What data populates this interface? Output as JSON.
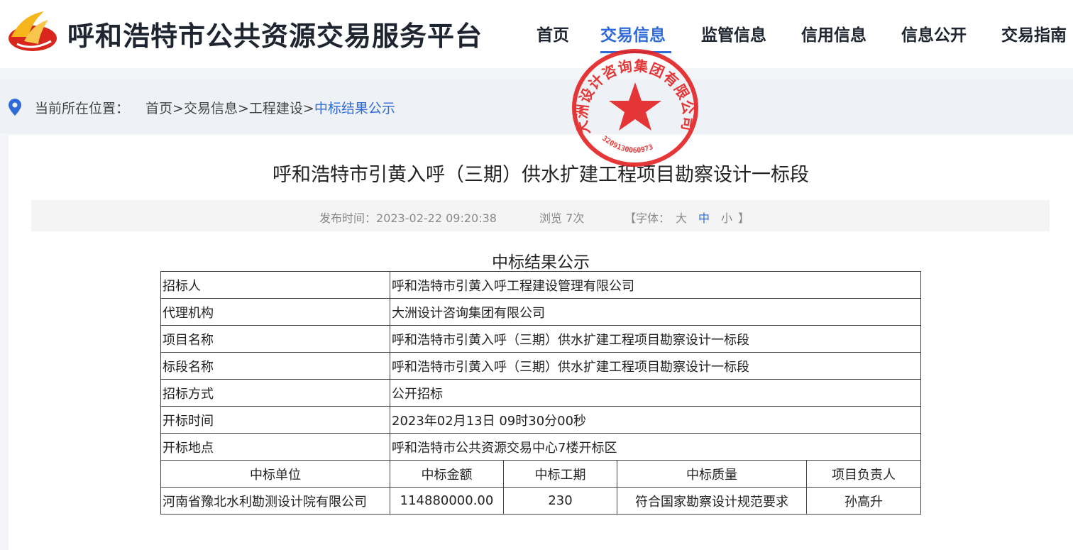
{
  "header": {
    "site_title": "呼和浩特市公共资源交易服务平台",
    "nav": [
      {
        "label": "首页",
        "active": false
      },
      {
        "label": "交易信息",
        "active": true
      },
      {
        "label": "监管信息",
        "active": false
      },
      {
        "label": "信用信息",
        "active": false
      },
      {
        "label": "信息公开",
        "active": false
      },
      {
        "label": "交易指南",
        "active": false
      }
    ]
  },
  "breadcrumb": {
    "prefix": "当前所在位置：",
    "items": [
      "首页",
      "交易信息",
      "工程建设"
    ],
    "separator": ">",
    "current": "中标结果公示"
  },
  "article": {
    "title": "呼和浩特市引黄入呼（三期）供水扩建工程项目勘察设计一标段",
    "publish_label": "发布时间：",
    "publish_time": "2023-02-22 09:20:38",
    "views": "浏览 7次",
    "font_label": "【字体：",
    "font_options": [
      "大",
      "中",
      "小"
    ],
    "font_close": "】",
    "active_font": "中"
  },
  "result": {
    "caption": "中标结果公示",
    "rows": [
      {
        "label": "招标人",
        "value": "呼和浩特市引黄入呼工程建设管理有限公司"
      },
      {
        "label": "代理机构",
        "value": "大洲设计咨询集团有限公司"
      },
      {
        "label": "项目名称",
        "value": "呼和浩特市引黄入呼（三期）供水扩建工程项目勘察设计一标段"
      },
      {
        "label": "标段名称",
        "value": "呼和浩特市引黄入呼（三期）供水扩建工程项目勘察设计一标段"
      },
      {
        "label": "招标方式",
        "value": "公开招标"
      },
      {
        "label": "开标时间",
        "value": "2023年02月13日 09时30分00秒"
      },
      {
        "label": "开标地点",
        "value": "呼和浩特市公共资源交易中心7楼开标区"
      }
    ],
    "winner_headers": [
      "中标单位",
      "中标金额",
      "中标工期",
      "中标质量",
      "项目负责人"
    ],
    "winner_row": [
      "河南省豫北水利勘测设计院有限公司",
      "114880000.00",
      "230",
      "符合国家勘察设计规范要求",
      "孙高升"
    ]
  },
  "stamp": {
    "text": "大洲设计咨询集团有限公司",
    "code": "3209130060973"
  },
  "colors": {
    "accent": "#2f6bd8",
    "stamp_red": "#e32222",
    "logo_red": "#d9261c",
    "logo_yellow": "#f5b51b"
  }
}
